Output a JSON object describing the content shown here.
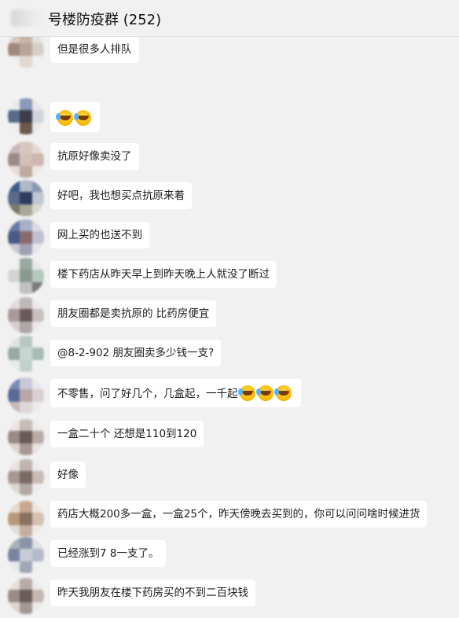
{
  "header": {
    "title": "号楼防疫群 (252)"
  },
  "messages": [
    {
      "text": "但是很多人排队",
      "emojis": 0,
      "avatar": [
        "#d8c8c0",
        "#c9b2a8",
        "#e4e0dc",
        "#a0897a",
        "#b8a497",
        "#d6cfc9",
        "#efeeee",
        "#e0d8d2",
        "#f0f0f0"
      ]
    },
    {
      "text": "",
      "emojis": 2,
      "avatar": [
        "#eaeaea",
        "#8a9ab8",
        "#e6e6e6",
        "#5a6b8a",
        "#3b3e4a",
        "#d0d4dc",
        "#eeeeee",
        "#6a5a4a",
        "#e8e8e8"
      ]
    },
    {
      "text": "抗原好像卖没了",
      "emojis": 0,
      "avatar": [
        "#c8b8b8",
        "#d9c6c0",
        "#e6dad4",
        "#9a8a8a",
        "#d4c0b8",
        "#cbb7b0",
        "#e8dcd6",
        "#bfa9a0",
        "#efe6e2"
      ]
    },
    {
      "text": "好吧，我也想买点抗原来着",
      "emojis": 0,
      "avatar": [
        "#3c5a8c",
        "#b0b8c8",
        "#8a98b0",
        "#5a6a8a",
        "#2e3c5e",
        "#c0c6d2",
        "#7a7a6a",
        "#a8a898",
        "#d8d8d0"
      ]
    },
    {
      "text": "网上买的也送不到",
      "emojis": 0,
      "avatar": [
        "#6a7aa8",
        "#a8b0c8",
        "#dcdce6",
        "#4a5a88",
        "#8a6a6a",
        "#c0c0d0",
        "#c8c8d4",
        "#a0a0b4",
        "#e6e6ec"
      ]
    },
    {
      "text": "楼下药店从昨天早上到昨天晚上人就没了断过",
      "emojis": 0,
      "avatar": [
        "#efefef",
        "#9aa8a0",
        "#e8e8e8",
        "#d4d4d4",
        "#8a9a90",
        "#b4c8be",
        "#eeeeee",
        "#c0c0c0",
        "#7a7a7a"
      ]
    },
    {
      "text": "朋友圈都是卖抗原的 比药房便宜",
      "emojis": 0,
      "avatar": [
        "#e0dcdc",
        "#c0b8b8",
        "#eeeaea",
        "#a89a9a",
        "#6a5a5a",
        "#c8c0c0",
        "#d8d0d0",
        "#b0a8a8",
        "#ece8e8"
      ]
    },
    {
      "text": "@8-2-902 朋友圈卖多少钱一支?",
      "emojis": 0,
      "avatar": [
        "#dce4e0",
        "#b8c8c0",
        "#eef2f0",
        "#98aaa4",
        "#c8d6d0",
        "#a8bcb4",
        "#e6ecea",
        "#c0d0ca",
        "#f0f2f2"
      ]
    },
    {
      "text": "不零售，问了好几个，几盒起，一千起",
      "emojis": 3,
      "avatar": [
        "#7a8ab8",
        "#c8c8d8",
        "#e8e8ee",
        "#5a6a98",
        "#b8a8a8",
        "#d8d0d0",
        "#c8b8b8",
        "#e0d8d8",
        "#eeeaea"
      ]
    },
    {
      "text": "一盒二十个 还想是110到120",
      "emojis": 0,
      "avatar": [
        "#e8e4e2",
        "#c8bcb8",
        "#ecebea",
        "#9a8a86",
        "#6a5a58",
        "#b8aca8",
        "#dcd4d0",
        "#a89894",
        "#e8e2e0"
      ]
    },
    {
      "text": "好像",
      "emojis": 0,
      "avatar": [
        "#e6e2e0",
        "#c0b4b0",
        "#ecebeb",
        "#a89894",
        "#7a6a66",
        "#c8bcb8",
        "#dcd6d4",
        "#b4a8a4",
        "#eeeaea"
      ]
    },
    {
      "text": "药店大概200多一盒，一盒25个，昨天傍晚去买到的，你可以问问啥时候进货",
      "emojis": 0,
      "avatar": [
        "#e8d8cc",
        "#c8a890",
        "#ece4de",
        "#b89878",
        "#8a7060",
        "#d4c0b0",
        "#e4dcd6",
        "#c4b0a0",
        "#eee8e4"
      ]
    },
    {
      "text": "已经涨到7 8一支了。",
      "emojis": 0,
      "avatar": [
        "#a8b0c0",
        "#8a94a8",
        "#dcdfe6",
        "#7a84a0",
        "#c8ccd6",
        "#b4bac8",
        "#e6e8ec",
        "#a0a8b8",
        "#eeeff2"
      ]
    },
    {
      "text": "昨天我朋友在楼下药房买的不到二百块钱",
      "emojis": 0,
      "avatar": [
        "#e4e0de",
        "#b8aca8",
        "#ecebeb",
        "#9a8c88",
        "#6a5c58",
        "#c4b8b4",
        "#dcd6d4",
        "#a49894",
        "#eeeaea"
      ]
    }
  ]
}
